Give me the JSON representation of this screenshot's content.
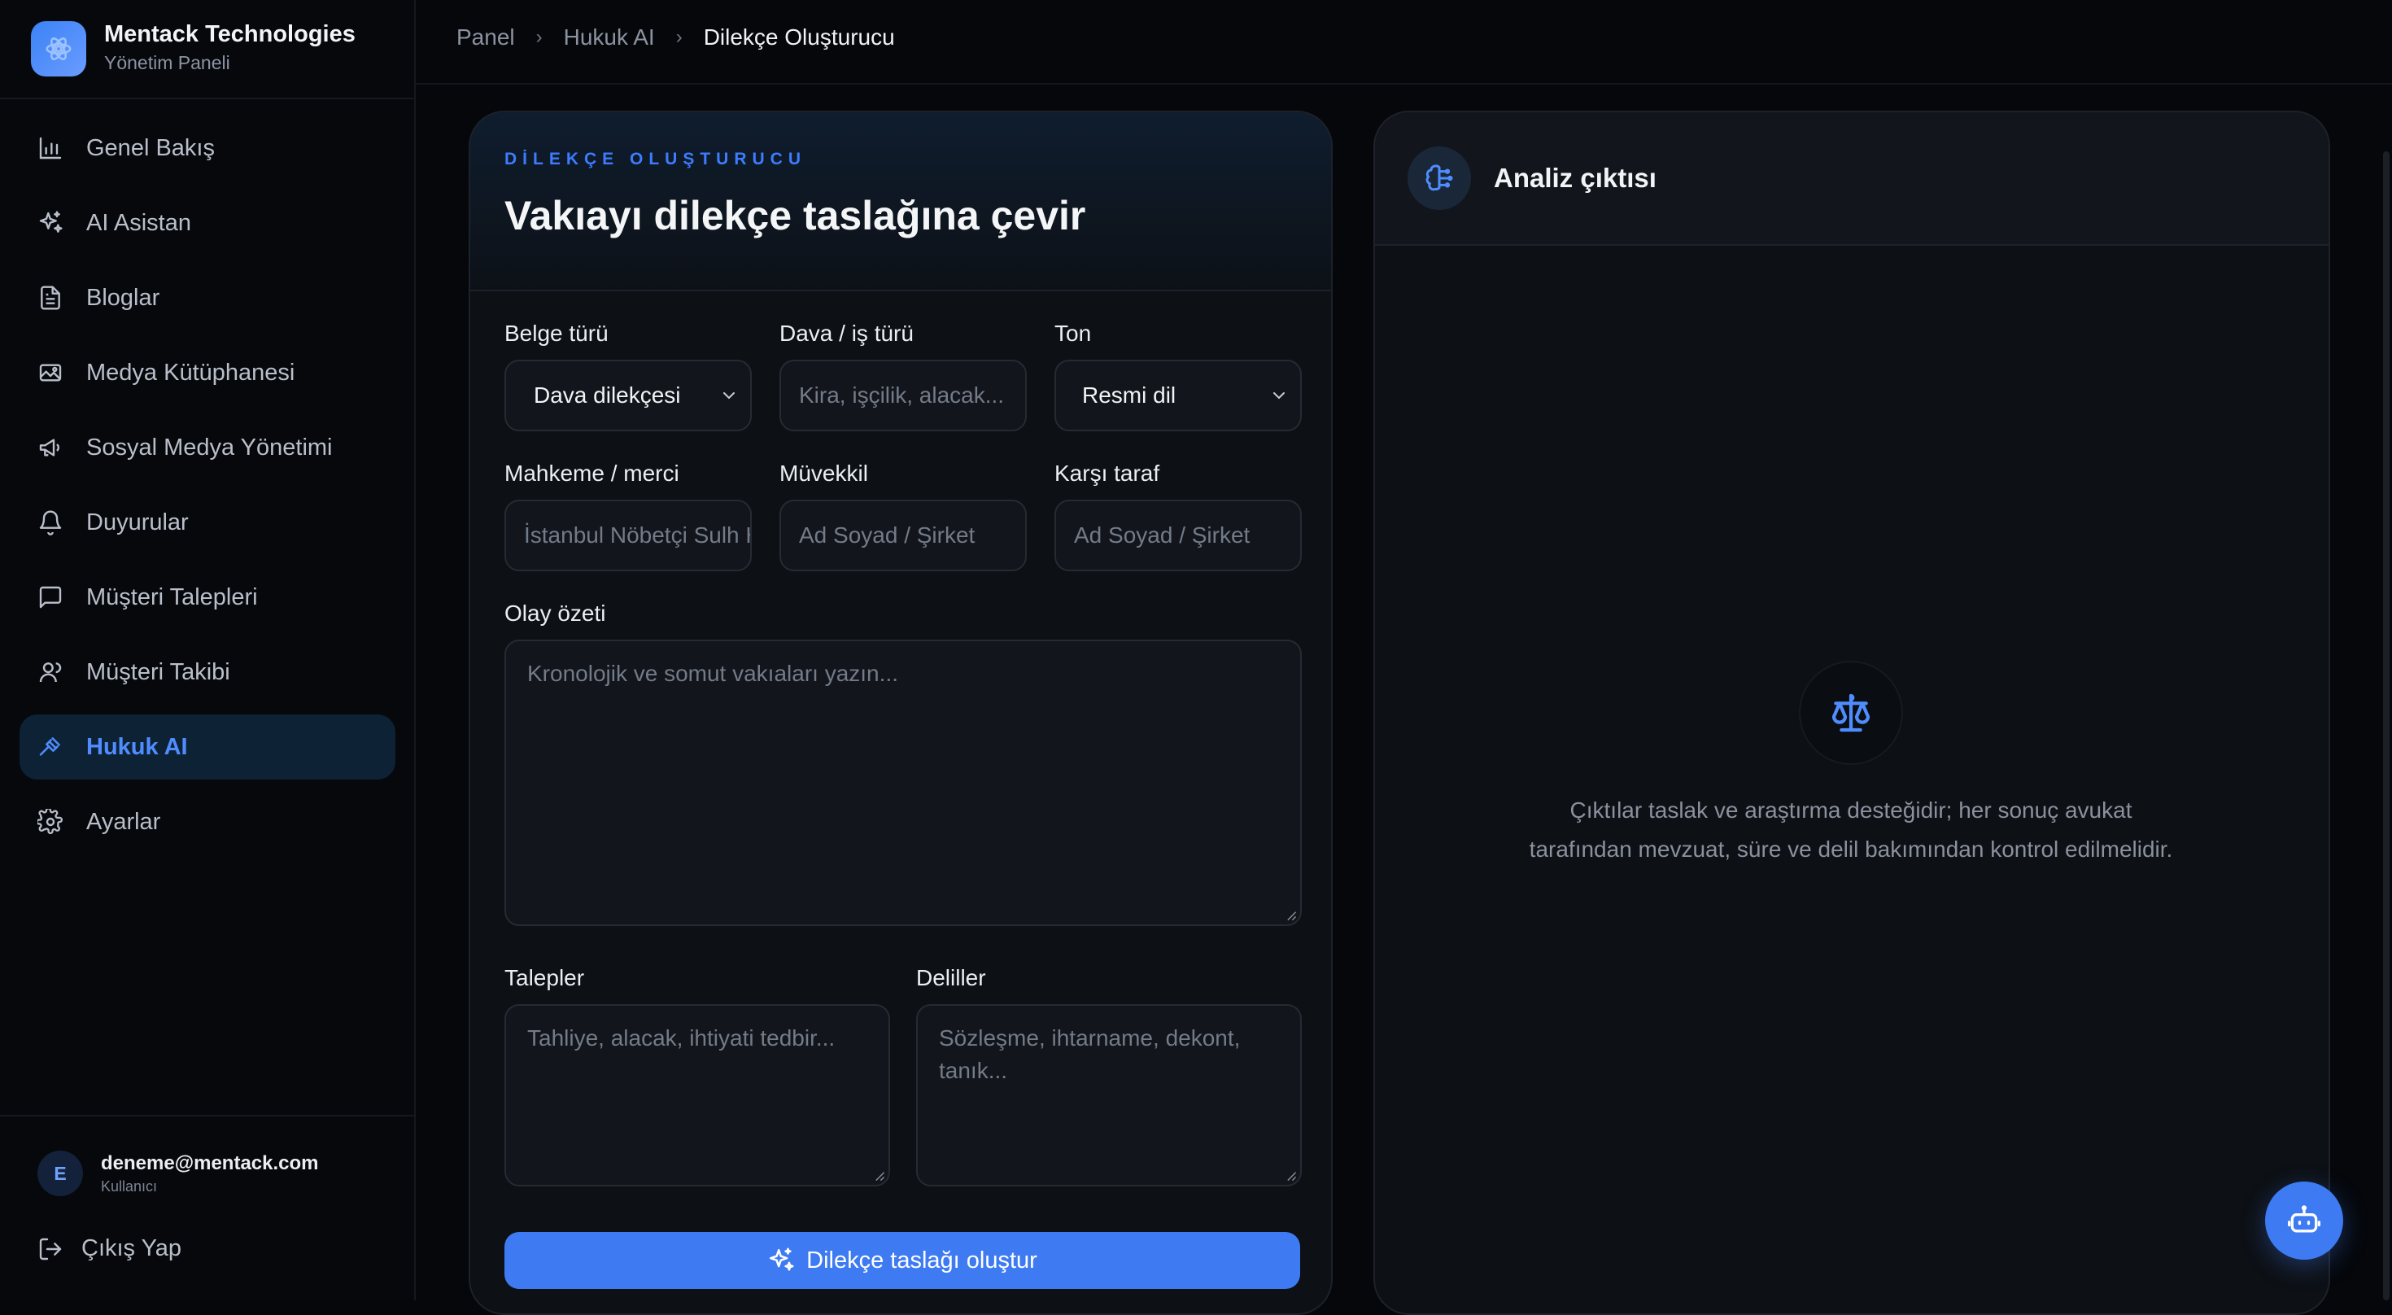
{
  "brand": {
    "name": "Mentack Technologies",
    "subtitle": "Yönetim Paneli"
  },
  "sidebar": {
    "items": [
      {
        "label": "Genel Bakış",
        "icon": "bar-chart-icon"
      },
      {
        "label": "AI Asistan",
        "icon": "sparkles-icon"
      },
      {
        "label": "Bloglar",
        "icon": "document-icon"
      },
      {
        "label": "Medya Kütüphanesi",
        "icon": "image-icon"
      },
      {
        "label": "Sosyal Medya Yönetimi",
        "icon": "megaphone-icon"
      },
      {
        "label": "Duyurular",
        "icon": "bell-icon"
      },
      {
        "label": "Müşteri Talepleri",
        "icon": "message-icon"
      },
      {
        "label": "Müşteri Takibi",
        "icon": "users-icon"
      },
      {
        "label": "Hukuk AI",
        "icon": "gavel-icon",
        "active": true
      },
      {
        "label": "Ayarlar",
        "icon": "gear-icon"
      }
    ]
  },
  "user": {
    "initial": "E",
    "email": "deneme@mentack.com",
    "role": "Kullanıcı",
    "logout_label": "Çıkış Yap"
  },
  "breadcrumb": {
    "items": [
      "Panel",
      "Hukuk AI"
    ],
    "current": "Dilekçe Oluşturucu"
  },
  "form": {
    "eyebrow": "DİLEKÇE OLUŞTURUCU",
    "title": "Vakıayı dilekçe taslağına çevir",
    "document_type": {
      "label": "Belge türü",
      "value": "Dava dilekçesi"
    },
    "case_type": {
      "label": "Dava / iş türü",
      "placeholder": "Kira, işçilik, alacak..."
    },
    "tone": {
      "label": "Ton",
      "value": "Resmi dil"
    },
    "court": {
      "label": "Mahkeme / merci",
      "placeholder": "İstanbul Nöbetçi Sulh Hukuk Mahkemesi"
    },
    "client": {
      "label": "Müvekkil",
      "placeholder": "Ad Soyad / Şirket"
    },
    "opponent": {
      "label": "Karşı taraf",
      "placeholder": "Ad Soyad / Şirket"
    },
    "summary": {
      "label": "Olay özeti",
      "placeholder": "Kronolojik ve somut vakıaları yazın..."
    },
    "demands": {
      "label": "Talepler",
      "placeholder": "Tahliye, alacak, ihtiyati tedbir..."
    },
    "evidence": {
      "label": "Deliller",
      "placeholder": "Sözleşme, ihtarname, dekont, tanık..."
    },
    "submit_label": "Dilekçe taslağı oluştur"
  },
  "output": {
    "title": "Analiz çıktısı",
    "empty_text": "Çıktılar taslak ve araştırma desteğidir; her sonuç avukat tarafından mevzuat, süre ve delil bakımından kontrol edilmelidir."
  },
  "colors": {
    "accent": "#3e7bf2",
    "active_nav_bg": "#0e2236",
    "background": "#05070b"
  }
}
